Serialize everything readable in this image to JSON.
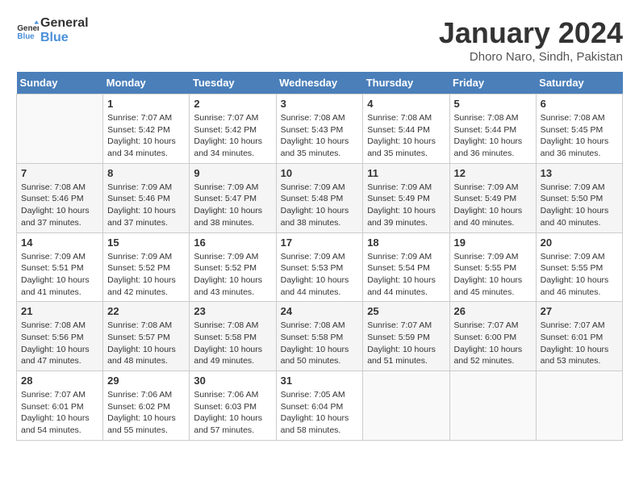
{
  "header": {
    "logo_line1": "General",
    "logo_line2": "Blue",
    "month_title": "January 2024",
    "location": "Dhoro Naro, Sindh, Pakistan"
  },
  "weekdays": [
    "Sunday",
    "Monday",
    "Tuesday",
    "Wednesday",
    "Thursday",
    "Friday",
    "Saturday"
  ],
  "weeks": [
    [
      {
        "day": "",
        "sunrise": "",
        "sunset": "",
        "daylight": ""
      },
      {
        "day": "1",
        "sunrise": "Sunrise: 7:07 AM",
        "sunset": "Sunset: 5:42 PM",
        "daylight": "Daylight: 10 hours and 34 minutes."
      },
      {
        "day": "2",
        "sunrise": "Sunrise: 7:07 AM",
        "sunset": "Sunset: 5:42 PM",
        "daylight": "Daylight: 10 hours and 34 minutes."
      },
      {
        "day": "3",
        "sunrise": "Sunrise: 7:08 AM",
        "sunset": "Sunset: 5:43 PM",
        "daylight": "Daylight: 10 hours and 35 minutes."
      },
      {
        "day": "4",
        "sunrise": "Sunrise: 7:08 AM",
        "sunset": "Sunset: 5:44 PM",
        "daylight": "Daylight: 10 hours and 35 minutes."
      },
      {
        "day": "5",
        "sunrise": "Sunrise: 7:08 AM",
        "sunset": "Sunset: 5:44 PM",
        "daylight": "Daylight: 10 hours and 36 minutes."
      },
      {
        "day": "6",
        "sunrise": "Sunrise: 7:08 AM",
        "sunset": "Sunset: 5:45 PM",
        "daylight": "Daylight: 10 hours and 36 minutes."
      }
    ],
    [
      {
        "day": "7",
        "sunrise": "Sunrise: 7:08 AM",
        "sunset": "Sunset: 5:46 PM",
        "daylight": "Daylight: 10 hours and 37 minutes."
      },
      {
        "day": "8",
        "sunrise": "Sunrise: 7:09 AM",
        "sunset": "Sunset: 5:46 PM",
        "daylight": "Daylight: 10 hours and 37 minutes."
      },
      {
        "day": "9",
        "sunrise": "Sunrise: 7:09 AM",
        "sunset": "Sunset: 5:47 PM",
        "daylight": "Daylight: 10 hours and 38 minutes."
      },
      {
        "day": "10",
        "sunrise": "Sunrise: 7:09 AM",
        "sunset": "Sunset: 5:48 PM",
        "daylight": "Daylight: 10 hours and 38 minutes."
      },
      {
        "day": "11",
        "sunrise": "Sunrise: 7:09 AM",
        "sunset": "Sunset: 5:49 PM",
        "daylight": "Daylight: 10 hours and 39 minutes."
      },
      {
        "day": "12",
        "sunrise": "Sunrise: 7:09 AM",
        "sunset": "Sunset: 5:49 PM",
        "daylight": "Daylight: 10 hours and 40 minutes."
      },
      {
        "day": "13",
        "sunrise": "Sunrise: 7:09 AM",
        "sunset": "Sunset: 5:50 PM",
        "daylight": "Daylight: 10 hours and 40 minutes."
      }
    ],
    [
      {
        "day": "14",
        "sunrise": "Sunrise: 7:09 AM",
        "sunset": "Sunset: 5:51 PM",
        "daylight": "Daylight: 10 hours and 41 minutes."
      },
      {
        "day": "15",
        "sunrise": "Sunrise: 7:09 AM",
        "sunset": "Sunset: 5:52 PM",
        "daylight": "Daylight: 10 hours and 42 minutes."
      },
      {
        "day": "16",
        "sunrise": "Sunrise: 7:09 AM",
        "sunset": "Sunset: 5:52 PM",
        "daylight": "Daylight: 10 hours and 43 minutes."
      },
      {
        "day": "17",
        "sunrise": "Sunrise: 7:09 AM",
        "sunset": "Sunset: 5:53 PM",
        "daylight": "Daylight: 10 hours and 44 minutes."
      },
      {
        "day": "18",
        "sunrise": "Sunrise: 7:09 AM",
        "sunset": "Sunset: 5:54 PM",
        "daylight": "Daylight: 10 hours and 44 minutes."
      },
      {
        "day": "19",
        "sunrise": "Sunrise: 7:09 AM",
        "sunset": "Sunset: 5:55 PM",
        "daylight": "Daylight: 10 hours and 45 minutes."
      },
      {
        "day": "20",
        "sunrise": "Sunrise: 7:09 AM",
        "sunset": "Sunset: 5:55 PM",
        "daylight": "Daylight: 10 hours and 46 minutes."
      }
    ],
    [
      {
        "day": "21",
        "sunrise": "Sunrise: 7:08 AM",
        "sunset": "Sunset: 5:56 PM",
        "daylight": "Daylight: 10 hours and 47 minutes."
      },
      {
        "day": "22",
        "sunrise": "Sunrise: 7:08 AM",
        "sunset": "Sunset: 5:57 PM",
        "daylight": "Daylight: 10 hours and 48 minutes."
      },
      {
        "day": "23",
        "sunrise": "Sunrise: 7:08 AM",
        "sunset": "Sunset: 5:58 PM",
        "daylight": "Daylight: 10 hours and 49 minutes."
      },
      {
        "day": "24",
        "sunrise": "Sunrise: 7:08 AM",
        "sunset": "Sunset: 5:58 PM",
        "daylight": "Daylight: 10 hours and 50 minutes."
      },
      {
        "day": "25",
        "sunrise": "Sunrise: 7:07 AM",
        "sunset": "Sunset: 5:59 PM",
        "daylight": "Daylight: 10 hours and 51 minutes."
      },
      {
        "day": "26",
        "sunrise": "Sunrise: 7:07 AM",
        "sunset": "Sunset: 6:00 PM",
        "daylight": "Daylight: 10 hours and 52 minutes."
      },
      {
        "day": "27",
        "sunrise": "Sunrise: 7:07 AM",
        "sunset": "Sunset: 6:01 PM",
        "daylight": "Daylight: 10 hours and 53 minutes."
      }
    ],
    [
      {
        "day": "28",
        "sunrise": "Sunrise: 7:07 AM",
        "sunset": "Sunset: 6:01 PM",
        "daylight": "Daylight: 10 hours and 54 minutes."
      },
      {
        "day": "29",
        "sunrise": "Sunrise: 7:06 AM",
        "sunset": "Sunset: 6:02 PM",
        "daylight": "Daylight: 10 hours and 55 minutes."
      },
      {
        "day": "30",
        "sunrise": "Sunrise: 7:06 AM",
        "sunset": "Sunset: 6:03 PM",
        "daylight": "Daylight: 10 hours and 57 minutes."
      },
      {
        "day": "31",
        "sunrise": "Sunrise: 7:05 AM",
        "sunset": "Sunset: 6:04 PM",
        "daylight": "Daylight: 10 hours and 58 minutes."
      },
      {
        "day": "",
        "sunrise": "",
        "sunset": "",
        "daylight": ""
      },
      {
        "day": "",
        "sunrise": "",
        "sunset": "",
        "daylight": ""
      },
      {
        "day": "",
        "sunrise": "",
        "sunset": "",
        "daylight": ""
      }
    ]
  ]
}
